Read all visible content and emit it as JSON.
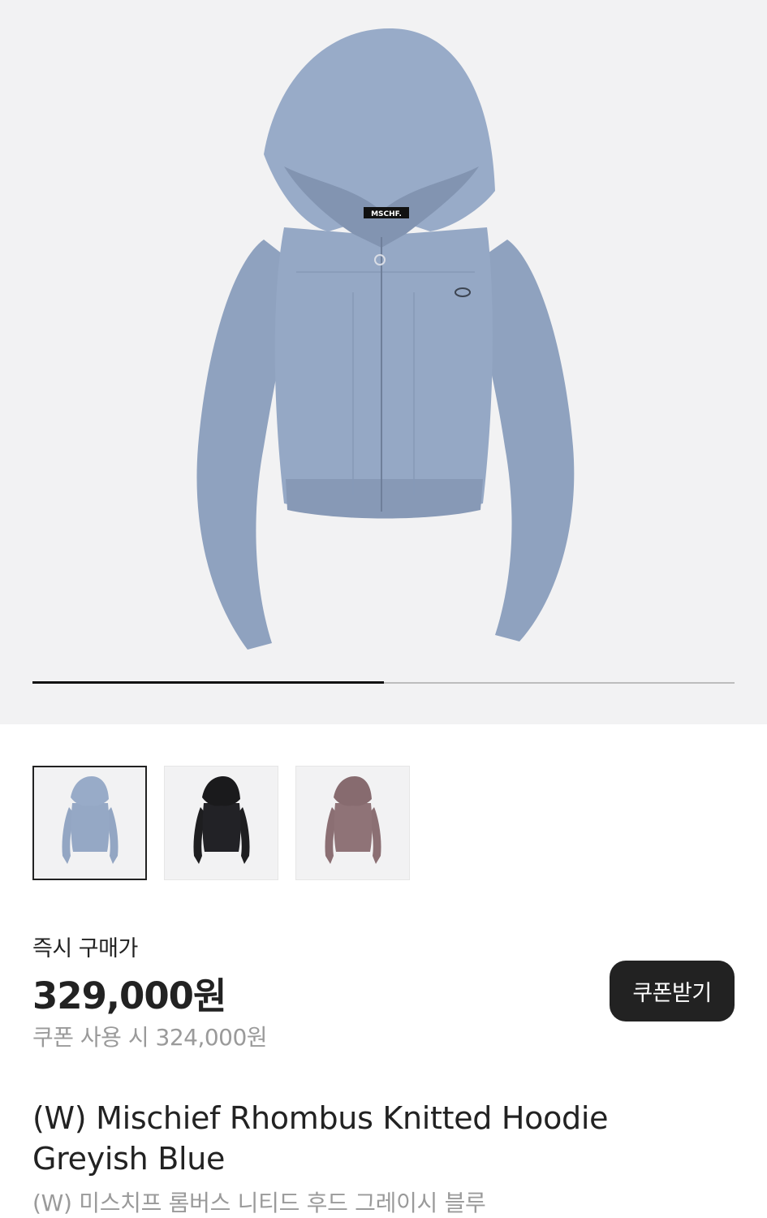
{
  "product_image": {
    "brand_tag": "MSCHF.",
    "slide_progress": 0.5,
    "colors": {
      "garment": "#93a6c3",
      "background": "#f2f2f3"
    }
  },
  "thumbnails": [
    {
      "variant": "greyish-blue",
      "color": "#93a6c3",
      "selected": true
    },
    {
      "variant": "black",
      "color": "#1e1e20",
      "selected": false
    },
    {
      "variant": "mauve",
      "color": "#8b6f73",
      "selected": false
    }
  ],
  "pricing": {
    "label": "즉시 구매가",
    "price": "329,000원",
    "coupon_price": "쿠폰 사용 시 324,000원",
    "coupon_button": "쿠폰받기"
  },
  "product": {
    "title_en_line1": "(W) Mischief Rhombus Knitted Hoodie",
    "title_en_line2": "Greyish Blue",
    "title_ko": "(W) 미스치프 롬버스 니티드 후드 그레이시 블루"
  }
}
